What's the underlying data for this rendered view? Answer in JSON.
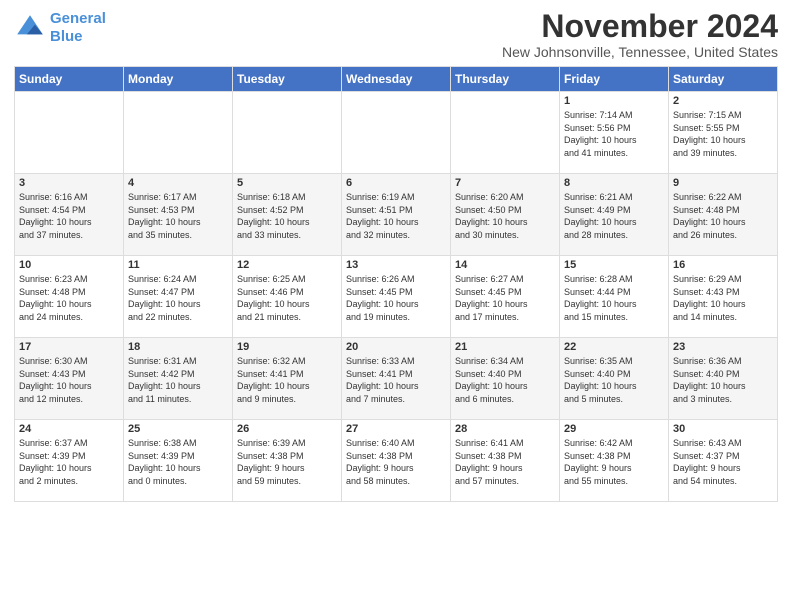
{
  "header": {
    "logo_line1": "General",
    "logo_line2": "Blue",
    "month_title": "November 2024",
    "location": "New Johnsonville, Tennessee, United States"
  },
  "days_of_week": [
    "Sunday",
    "Monday",
    "Tuesday",
    "Wednesday",
    "Thursday",
    "Friday",
    "Saturday"
  ],
  "weeks": [
    [
      {
        "day": "",
        "info": ""
      },
      {
        "day": "",
        "info": ""
      },
      {
        "day": "",
        "info": ""
      },
      {
        "day": "",
        "info": ""
      },
      {
        "day": "",
        "info": ""
      },
      {
        "day": "1",
        "info": "Sunrise: 7:14 AM\nSunset: 5:56 PM\nDaylight: 10 hours\nand 41 minutes."
      },
      {
        "day": "2",
        "info": "Sunrise: 7:15 AM\nSunset: 5:55 PM\nDaylight: 10 hours\nand 39 minutes."
      }
    ],
    [
      {
        "day": "3",
        "info": "Sunrise: 6:16 AM\nSunset: 4:54 PM\nDaylight: 10 hours\nand 37 minutes."
      },
      {
        "day": "4",
        "info": "Sunrise: 6:17 AM\nSunset: 4:53 PM\nDaylight: 10 hours\nand 35 minutes."
      },
      {
        "day": "5",
        "info": "Sunrise: 6:18 AM\nSunset: 4:52 PM\nDaylight: 10 hours\nand 33 minutes."
      },
      {
        "day": "6",
        "info": "Sunrise: 6:19 AM\nSunset: 4:51 PM\nDaylight: 10 hours\nand 32 minutes."
      },
      {
        "day": "7",
        "info": "Sunrise: 6:20 AM\nSunset: 4:50 PM\nDaylight: 10 hours\nand 30 minutes."
      },
      {
        "day": "8",
        "info": "Sunrise: 6:21 AM\nSunset: 4:49 PM\nDaylight: 10 hours\nand 28 minutes."
      },
      {
        "day": "9",
        "info": "Sunrise: 6:22 AM\nSunset: 4:48 PM\nDaylight: 10 hours\nand 26 minutes."
      }
    ],
    [
      {
        "day": "10",
        "info": "Sunrise: 6:23 AM\nSunset: 4:48 PM\nDaylight: 10 hours\nand 24 minutes."
      },
      {
        "day": "11",
        "info": "Sunrise: 6:24 AM\nSunset: 4:47 PM\nDaylight: 10 hours\nand 22 minutes."
      },
      {
        "day": "12",
        "info": "Sunrise: 6:25 AM\nSunset: 4:46 PM\nDaylight: 10 hours\nand 21 minutes."
      },
      {
        "day": "13",
        "info": "Sunrise: 6:26 AM\nSunset: 4:45 PM\nDaylight: 10 hours\nand 19 minutes."
      },
      {
        "day": "14",
        "info": "Sunrise: 6:27 AM\nSunset: 4:45 PM\nDaylight: 10 hours\nand 17 minutes."
      },
      {
        "day": "15",
        "info": "Sunrise: 6:28 AM\nSunset: 4:44 PM\nDaylight: 10 hours\nand 15 minutes."
      },
      {
        "day": "16",
        "info": "Sunrise: 6:29 AM\nSunset: 4:43 PM\nDaylight: 10 hours\nand 14 minutes."
      }
    ],
    [
      {
        "day": "17",
        "info": "Sunrise: 6:30 AM\nSunset: 4:43 PM\nDaylight: 10 hours\nand 12 minutes."
      },
      {
        "day": "18",
        "info": "Sunrise: 6:31 AM\nSunset: 4:42 PM\nDaylight: 10 hours\nand 11 minutes."
      },
      {
        "day": "19",
        "info": "Sunrise: 6:32 AM\nSunset: 4:41 PM\nDaylight: 10 hours\nand 9 minutes."
      },
      {
        "day": "20",
        "info": "Sunrise: 6:33 AM\nSunset: 4:41 PM\nDaylight: 10 hours\nand 7 minutes."
      },
      {
        "day": "21",
        "info": "Sunrise: 6:34 AM\nSunset: 4:40 PM\nDaylight: 10 hours\nand 6 minutes."
      },
      {
        "day": "22",
        "info": "Sunrise: 6:35 AM\nSunset: 4:40 PM\nDaylight: 10 hours\nand 5 minutes."
      },
      {
        "day": "23",
        "info": "Sunrise: 6:36 AM\nSunset: 4:40 PM\nDaylight: 10 hours\nand 3 minutes."
      }
    ],
    [
      {
        "day": "24",
        "info": "Sunrise: 6:37 AM\nSunset: 4:39 PM\nDaylight: 10 hours\nand 2 minutes."
      },
      {
        "day": "25",
        "info": "Sunrise: 6:38 AM\nSunset: 4:39 PM\nDaylight: 10 hours\nand 0 minutes."
      },
      {
        "day": "26",
        "info": "Sunrise: 6:39 AM\nSunset: 4:38 PM\nDaylight: 9 hours\nand 59 minutes."
      },
      {
        "day": "27",
        "info": "Sunrise: 6:40 AM\nSunset: 4:38 PM\nDaylight: 9 hours\nand 58 minutes."
      },
      {
        "day": "28",
        "info": "Sunrise: 6:41 AM\nSunset: 4:38 PM\nDaylight: 9 hours\nand 57 minutes."
      },
      {
        "day": "29",
        "info": "Sunrise: 6:42 AM\nSunset: 4:38 PM\nDaylight: 9 hours\nand 55 minutes."
      },
      {
        "day": "30",
        "info": "Sunrise: 6:43 AM\nSunset: 4:37 PM\nDaylight: 9 hours\nand 54 minutes."
      }
    ]
  ]
}
